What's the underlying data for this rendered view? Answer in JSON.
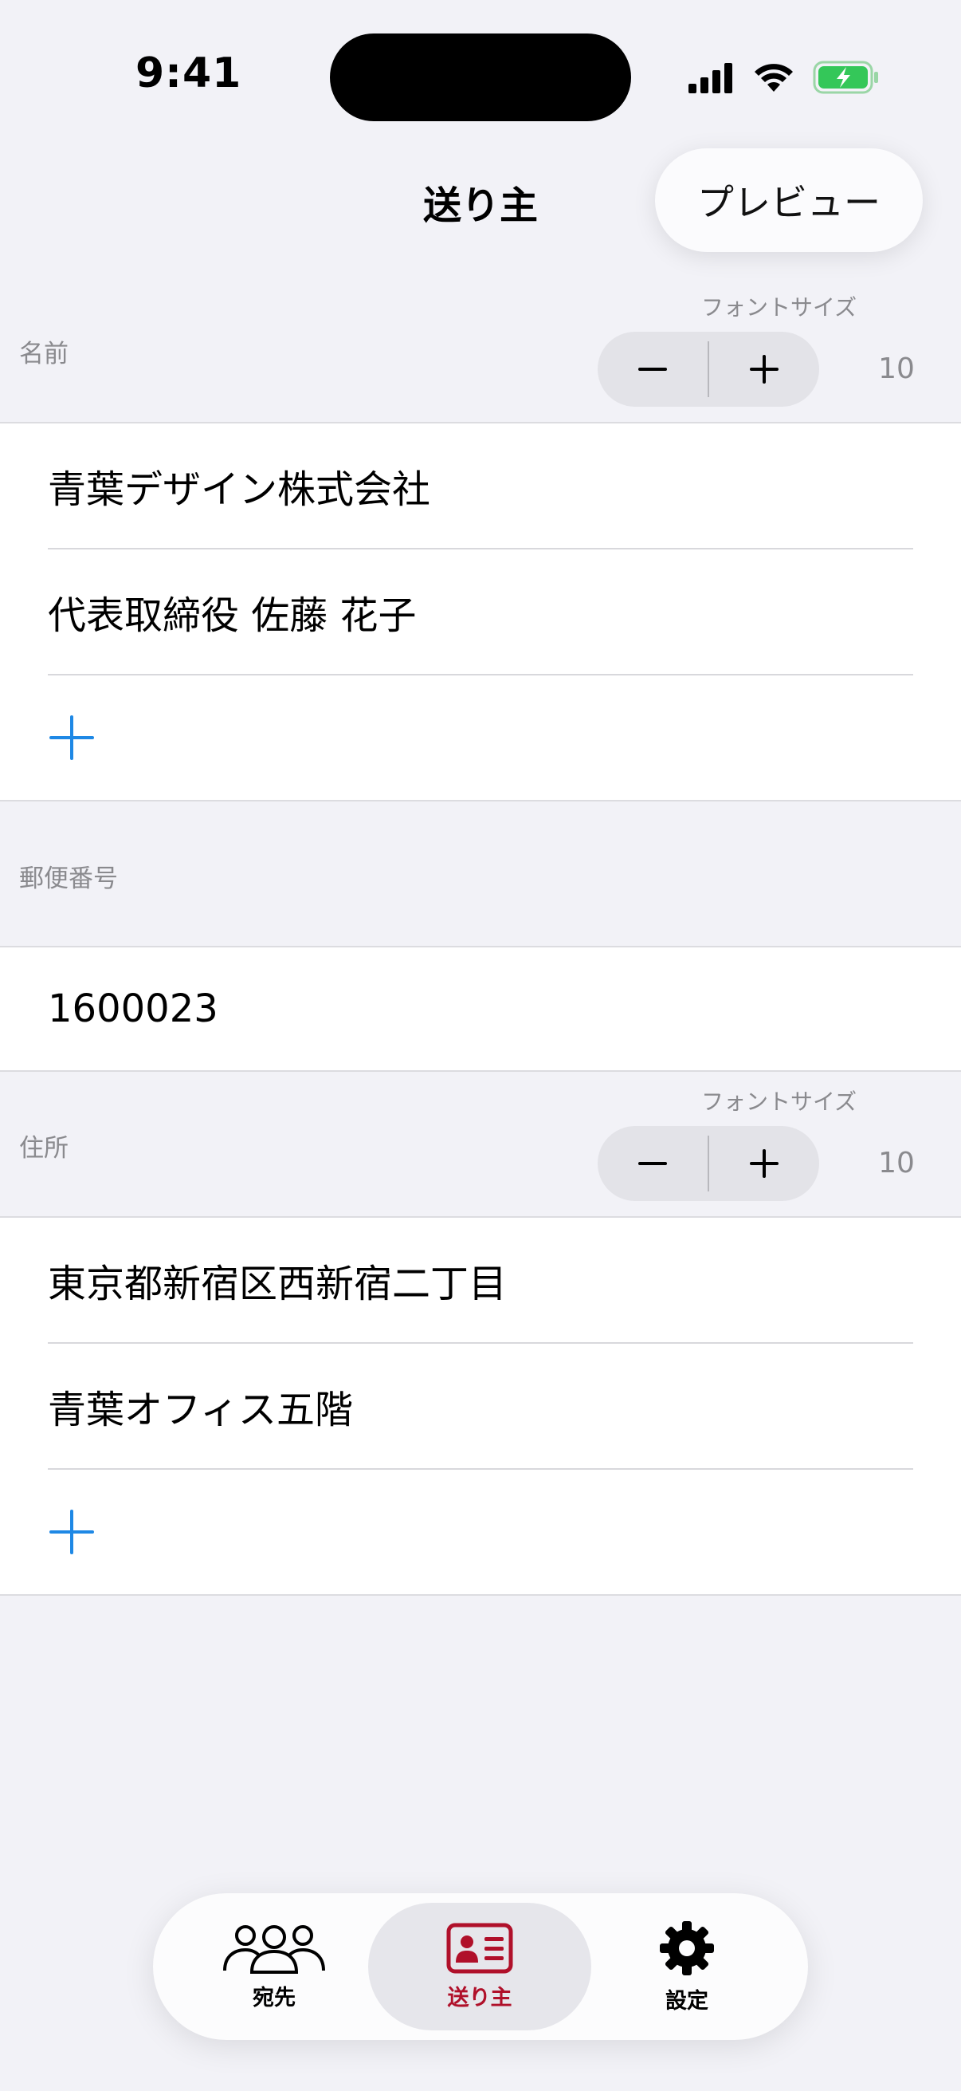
{
  "status_bar": {
    "time": "9:41",
    "signal_icon": "cellular-signal-icon",
    "wifi_icon": "wifi-icon",
    "battery_icon": "battery-charging-icon"
  },
  "nav": {
    "title": "送り主",
    "preview_label": "プレビュー"
  },
  "name_section": {
    "label": "名前",
    "font_size_caption": "フォントサイズ",
    "font_size_value": "10",
    "rows": [
      "青葉デザイン株式会社",
      "代表取締役 佐藤 花子"
    ]
  },
  "postal_section": {
    "label": "郵便番号",
    "value": "1600023"
  },
  "address_section": {
    "label": "住所",
    "font_size_caption": "フォントサイズ",
    "font_size_value": "10",
    "rows": [
      "東京都新宿区西新宿二丁目",
      "青葉オフィス五階"
    ]
  },
  "tabs": [
    {
      "label": "宛先",
      "icon": "people-icon"
    },
    {
      "label": "送り主",
      "icon": "contact-card-icon",
      "active": true
    },
    {
      "label": "設定",
      "icon": "gear-icon"
    }
  ],
  "colors": {
    "accent": "#1e88e5",
    "active_tab": "#b0102a",
    "background": "#f2f2f7",
    "battery": "#34c759"
  }
}
